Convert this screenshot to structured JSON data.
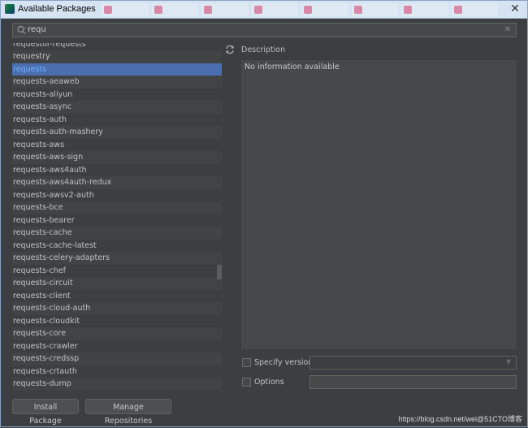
{
  "window": {
    "title": "Available Packages"
  },
  "search": {
    "value": "requ"
  },
  "packages": [
    "requestor-requests",
    "requestry",
    "requests",
    "requests-aeaweb",
    "requests-aliyun",
    "requests-async",
    "requests-auth",
    "requests-auth-mashery",
    "requests-aws",
    "requests-aws-sign",
    "requests-aws4auth",
    "requests-aws4auth-redux",
    "requests-awsv2-auth",
    "requests-bce",
    "requests-bearer",
    "requests-cache",
    "requests-cache-latest",
    "requests-celery-adapters",
    "requests-chef",
    "requests-circuit",
    "requests-client",
    "requests-cloud-auth",
    "requests-cloudkit",
    "requests-core",
    "requests-crawler",
    "requests-credssp",
    "requests-crtauth",
    "requests-dump"
  ],
  "selected_package": "requests",
  "description": {
    "label": "Description",
    "text": "No information available"
  },
  "options": {
    "specify_version_label": "Specify version",
    "options_label": "Options"
  },
  "buttons": {
    "install": "Install Package",
    "manage": "Manage Repositories"
  },
  "watermark": "https://blog.csdn.net/wei@51CTO博客",
  "colors": {
    "background": "#3c3f41",
    "selection": "#4b6eaf",
    "selected_text": "#6fb3ff"
  }
}
